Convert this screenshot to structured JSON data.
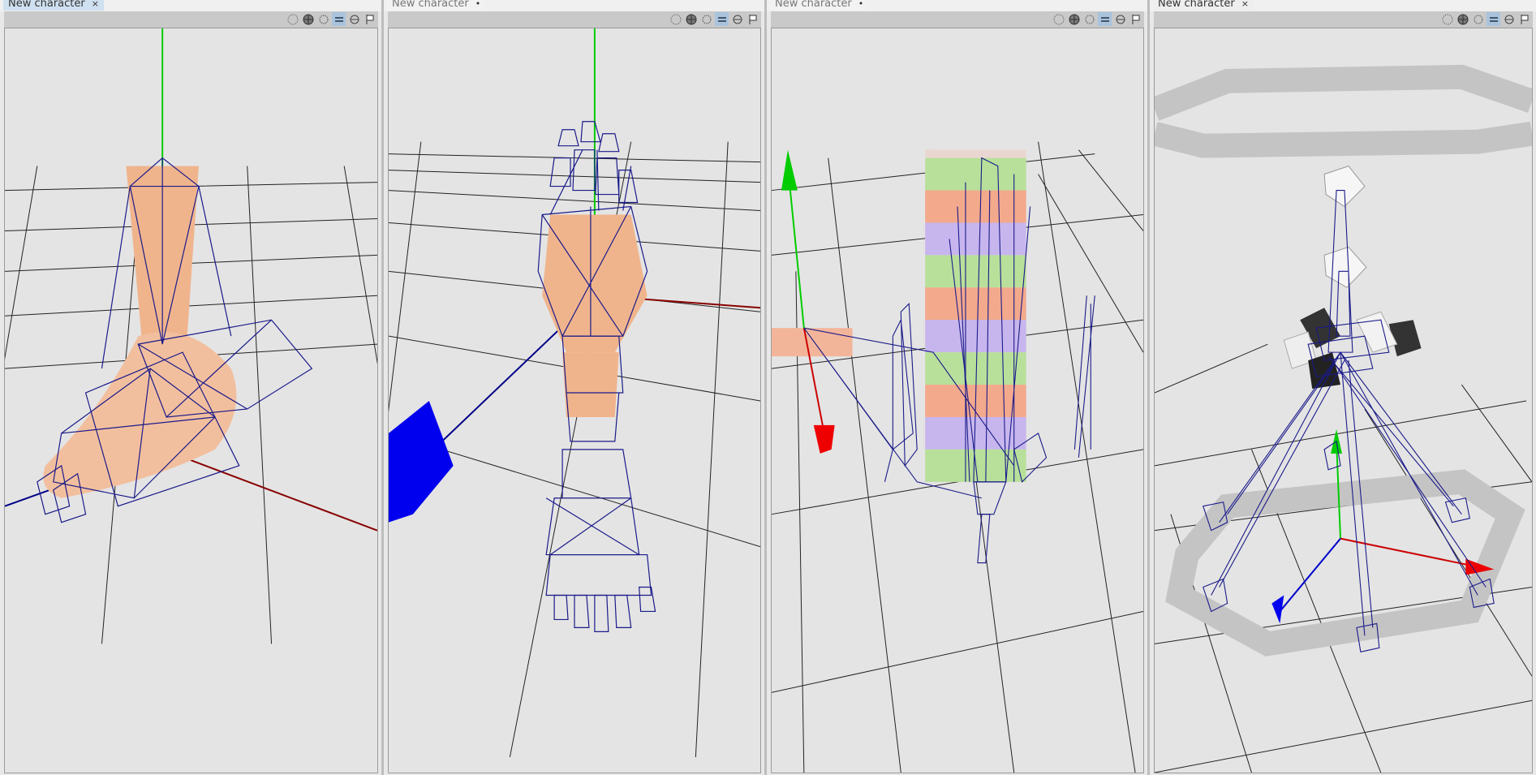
{
  "panes": [
    {
      "tab_label": "New character",
      "tab_active": true,
      "tab_close": "×"
    },
    {
      "tab_label": "New character",
      "tab_active": false,
      "tab_close": "•"
    },
    {
      "tab_label": "New character",
      "tab_active": false,
      "tab_close": "•"
    },
    {
      "tab_label": "New character",
      "tab_active": true,
      "tab_close": "×"
    }
  ],
  "toolbar_icons": [
    "points-icon",
    "wireframe-sphere-icon",
    "gear-dots-icon",
    "bone-icon",
    "capsule-icon",
    "flag-icon"
  ],
  "colors": {
    "bone_wire": "#1a1a8a",
    "skin": "#f0b48c",
    "grid": "#222222",
    "axis_x": "#cc0000",
    "axis_y": "#00cc00",
    "axis_z": "#0000ee"
  }
}
